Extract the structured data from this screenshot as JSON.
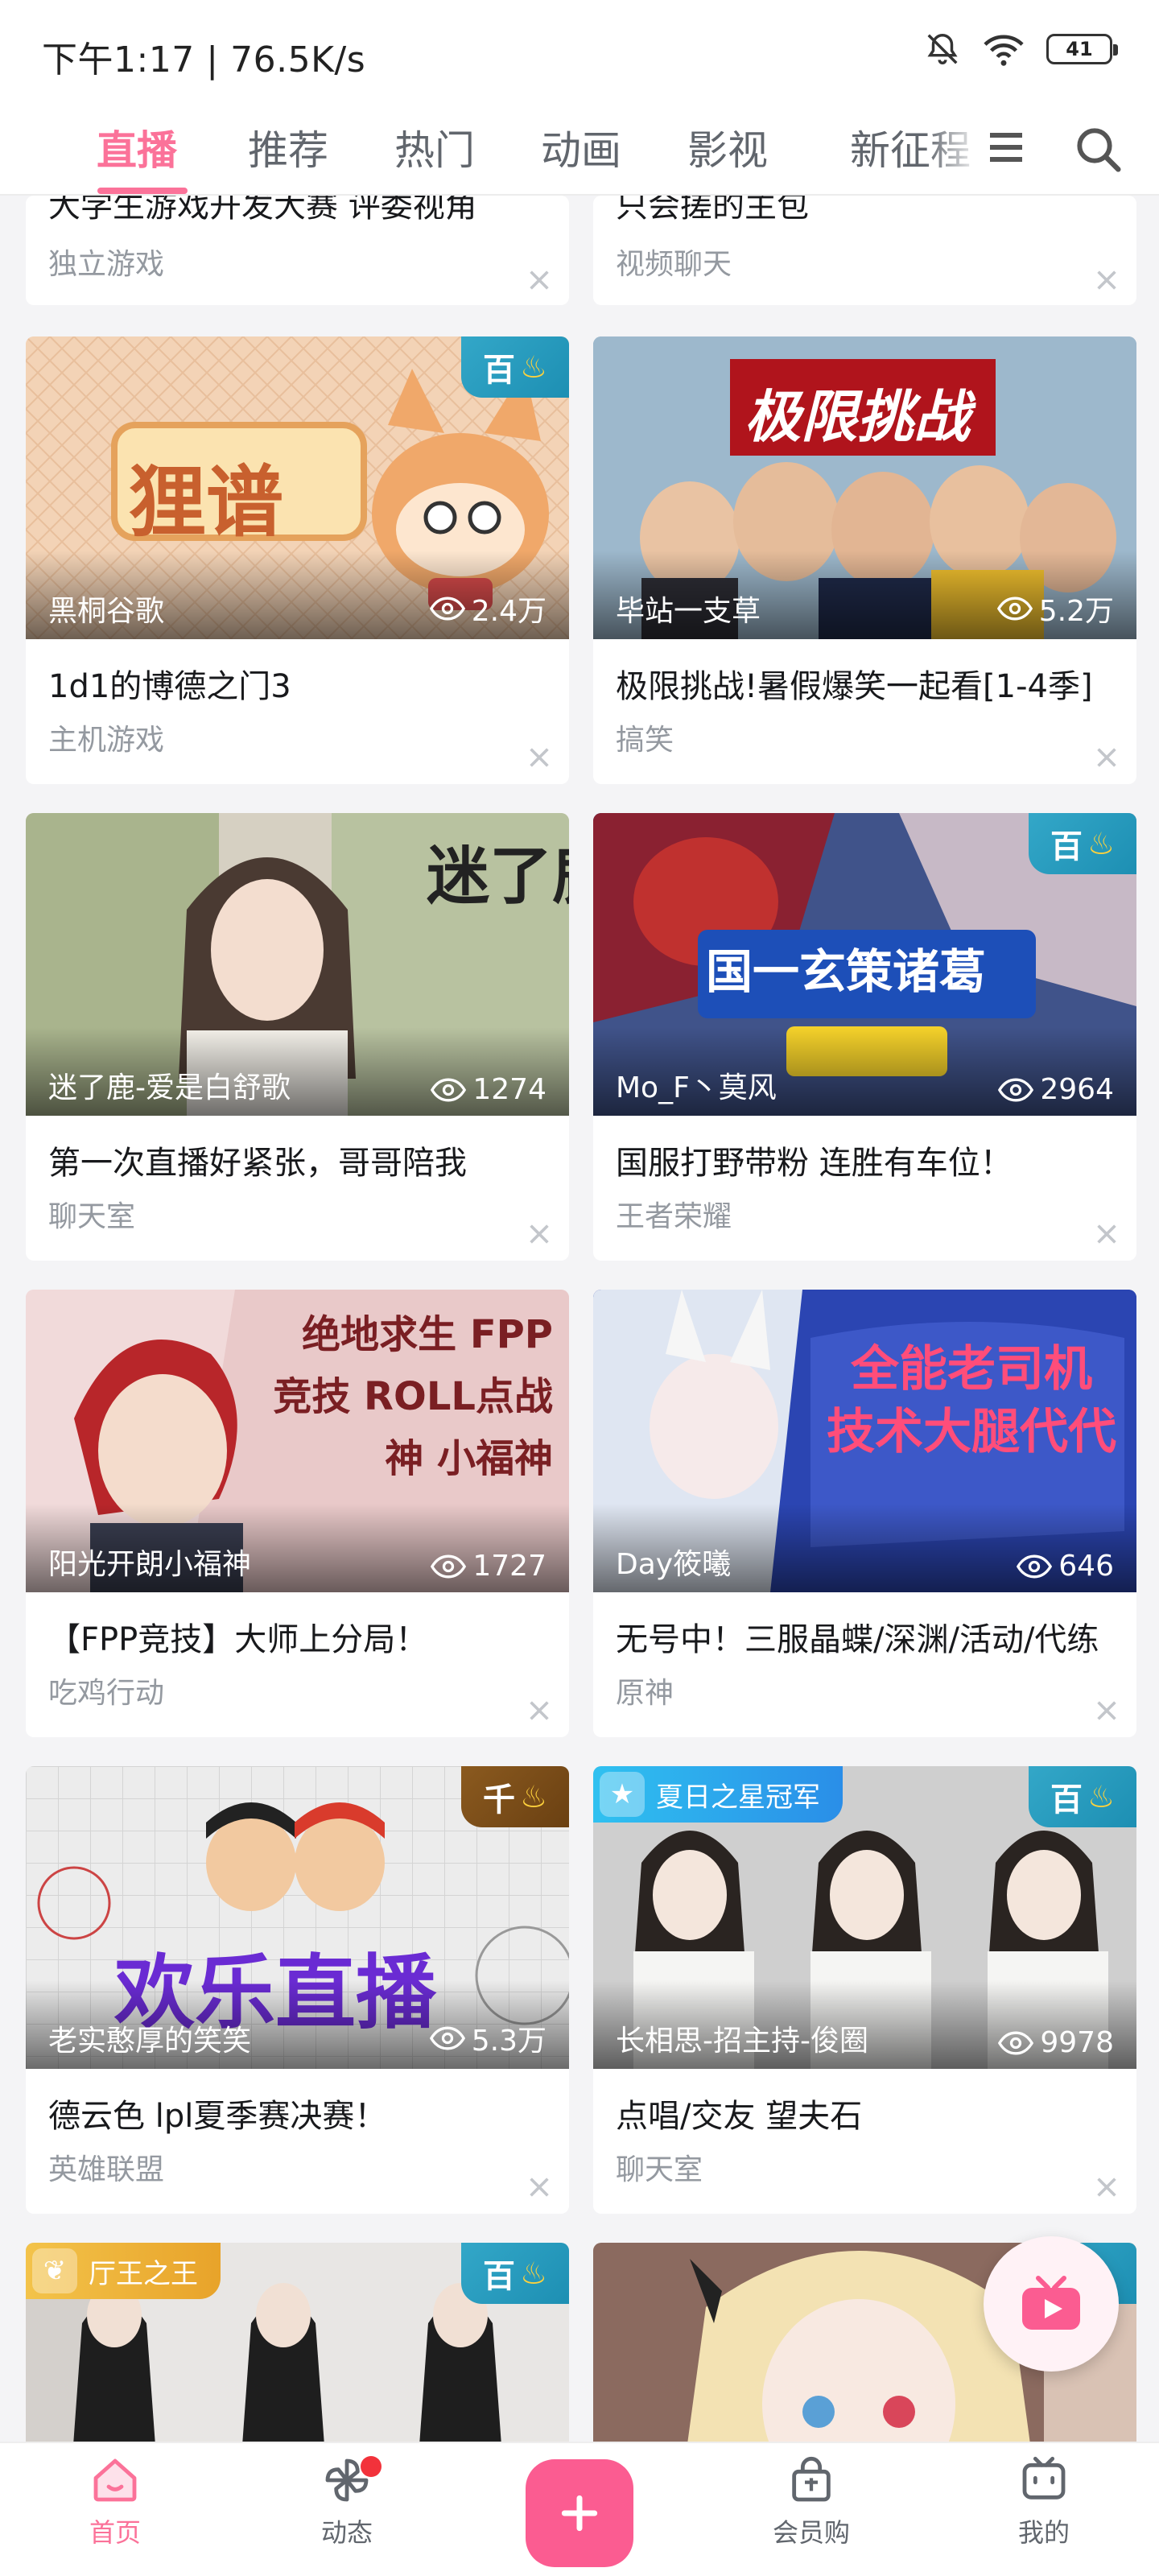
{
  "status_bar": {
    "time_speed": "下午1:17 | 76.5K/s",
    "battery": "41"
  },
  "top_tabs": [
    "直播",
    "推荐",
    "热门",
    "动画",
    "影视",
    "新征程"
  ],
  "colors": {
    "accent": "#fb7299",
    "badge": "#1d8fb3"
  },
  "feed": {
    "partial_cards": [
      {
        "title": "大学生游戏开发大赛 评委视角",
        "category": "独立游戏"
      },
      {
        "title": "只会搓的主包",
        "category": "视频聊天"
      }
    ],
    "cards": [
      {
        "streamer": "黑桐谷歌",
        "viewers": "2.4万",
        "title": "1d1的博德之门3",
        "category": "主机游戏",
        "badge": "百",
        "cover_text": "狸谱"
      },
      {
        "streamer": "毕站一支草",
        "viewers": "5.2万",
        "title": "极限挑战!暑假爆笑一起看[1-4季]",
        "category": "搞笑",
        "cover_text": "极限挑战"
      },
      {
        "streamer": "迷了鹿-爱是白舒歌",
        "viewers": "1274",
        "title": "第一次直播好紧张，哥哥陪我",
        "category": "聊天室",
        "cover_text": "迷了鹿"
      },
      {
        "streamer": "Mo_F丶莫风",
        "viewers": "2964",
        "title": "国服打野带粉 连胜有车位！",
        "category": "王者荣耀",
        "badge": "百",
        "cover_text": "国一玄策诸葛"
      },
      {
        "streamer": "阳光开朗小福神",
        "viewers": "1727",
        "title": "【FPP竞技】大师上分局！",
        "category": "吃鸡行动",
        "cover_text": "绝地求生 FPP竞技 ROLL点战神 小福神"
      },
      {
        "streamer": "Day筱曦",
        "viewers": "646",
        "title": "无号中！三服晶蝶/深渊/活动/代练",
        "category": "原神",
        "cover_text": "全能老司机 技术大腿代代"
      },
      {
        "streamer": "老实憨厚的笑笑",
        "viewers": "5.3万",
        "title": "德云色 lpl夏季赛决赛！",
        "category": "英雄联盟",
        "badge": "千",
        "cover_text": "欢乐直播"
      },
      {
        "streamer": "长相思-招主持-俊圈",
        "viewers": "9978",
        "title": "点唱/交友 望夫石",
        "category": "聊天室",
        "badge": "百",
        "honor": "夏日之星冠军"
      }
    ],
    "bottom_partial": [
      {
        "honor": "厅王之王",
        "badge": "百"
      },
      {
        "badge": "百"
      }
    ]
  },
  "bottom_nav": {
    "home": "首页",
    "dynamic": "动态",
    "vip": "会员购",
    "mine": "我的"
  }
}
